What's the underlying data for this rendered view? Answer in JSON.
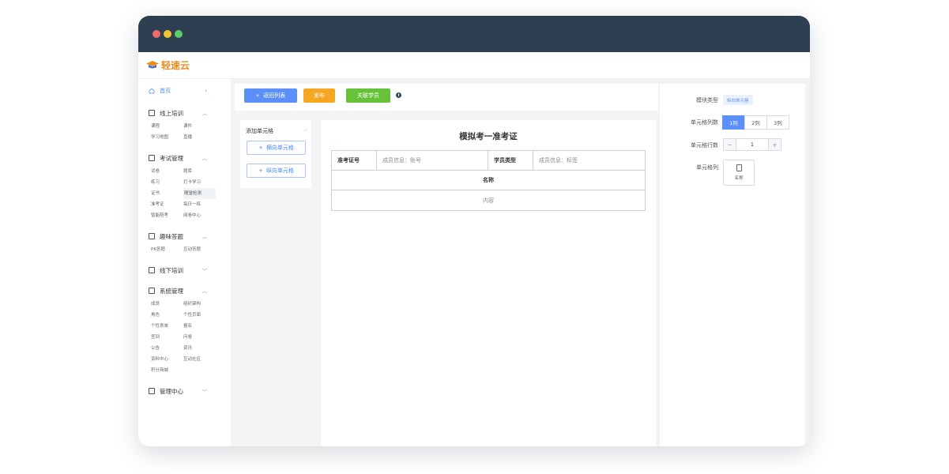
{
  "app": {
    "logo_text": "轻速云"
  },
  "sidebar": {
    "home": {
      "label": "首页"
    },
    "groups": [
      {
        "label": "线上培训",
        "expanded": true,
        "items": [
          "课程",
          "课件",
          "学习地图",
          "直播"
        ]
      },
      {
        "label": "考试管理",
        "expanded": true,
        "items": [
          "试卷",
          "题库",
          "练习",
          "打卡学习",
          "证书",
          "随堂检测",
          "准考证",
          "每日一练",
          "智能陪考",
          "阅卷中心"
        ]
      },
      {
        "label": "趣味答题",
        "expanded": true,
        "items": [
          "PK答题",
          "互动答题"
        ]
      },
      {
        "label": "线下培训",
        "expanded": false,
        "items": []
      },
      {
        "label": "系统管理",
        "expanded": true,
        "items": [
          "成员",
          "组织架构",
          "角色",
          "个性页面",
          "个性表单",
          "报名",
          "签到",
          "问卷",
          "公告",
          "资讯",
          "资料中心",
          "互动社区",
          "积分商城"
        ]
      },
      {
        "label": "管理中心",
        "expanded": false,
        "items": []
      }
    ],
    "active_item": "随堂检测"
  },
  "toolbar": {
    "back_label": "返回列表",
    "publish_label": "发布",
    "link_label": "关联学员"
  },
  "add_panel": {
    "title": "添加单元格",
    "horizontal_label": "横向单元格",
    "vertical_label": "纵向单元格"
  },
  "certificate": {
    "title": "模拟考一准考证",
    "rows": [
      [
        {
          "text": "准考证号",
          "kind": "label"
        },
        {
          "text": "成员信息：账号",
          "kind": "value"
        },
        {
          "text": "学员类型",
          "kind": "label"
        },
        {
          "text": "成员信息：标签",
          "kind": "value"
        }
      ],
      [
        {
          "text": "名称",
          "kind": "label"
        }
      ],
      [
        {
          "text": "内容",
          "kind": "value"
        }
      ]
    ]
  },
  "properties": {
    "module_type_label": "模块类型",
    "module_type_value": "纵向单元格",
    "columns_label": "单元格列数",
    "column_options": [
      "1列",
      "2列",
      "3列"
    ],
    "selected_column": "1列",
    "rows_label": "单元格行数",
    "rows_value": "1",
    "decrement_symbol": "−",
    "increment_symbol": "+",
    "cell_column_label": "单元格列",
    "cell_card_label": "名称"
  },
  "colors": {
    "titlebar": "#2f3f52",
    "primary": "#5b8ff9",
    "publish": "#f5a623",
    "link": "#67c23a",
    "logo": "#f08a1c"
  }
}
